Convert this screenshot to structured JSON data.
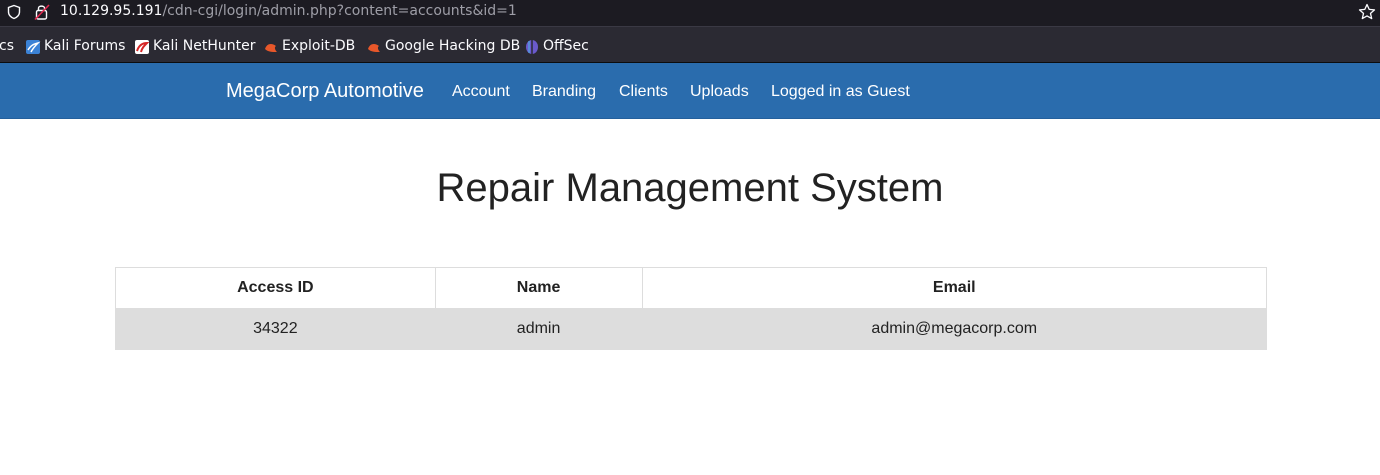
{
  "browser": {
    "url_host": "10.129.95.191",
    "url_path": "/cdn-cgi/login/admin.php?content=accounts&id=1",
    "icons": {
      "tracking": "shield-icon",
      "connection": "insecure-lock-icon",
      "bookmark": "star-icon"
    },
    "bookmarks": [
      {
        "label": "cs",
        "icon": ""
      },
      {
        "label": "Kali Forums",
        "icon": "kali-forums-icon"
      },
      {
        "label": "Kali NetHunter",
        "icon": "kali-nethunter-icon"
      },
      {
        "label": "Exploit-DB",
        "icon": "exploit-db-icon"
      },
      {
        "label": "Google Hacking DB",
        "icon": "ghdb-icon"
      },
      {
        "label": "OffSec",
        "icon": "offsec-icon"
      }
    ]
  },
  "navbar": {
    "brand": "MegaCorp Automotive",
    "links": [
      "Account",
      "Branding",
      "Clients",
      "Uploads",
      "Logged in as Guest"
    ],
    "color": "#2a6cad"
  },
  "main": {
    "title": "Repair Management System",
    "table": {
      "headers": [
        "Access ID",
        "Name",
        "Email"
      ],
      "rows": [
        [
          "34322",
          "admin",
          "admin@megacorp.com"
        ]
      ],
      "row_color": "#dddddd"
    }
  }
}
